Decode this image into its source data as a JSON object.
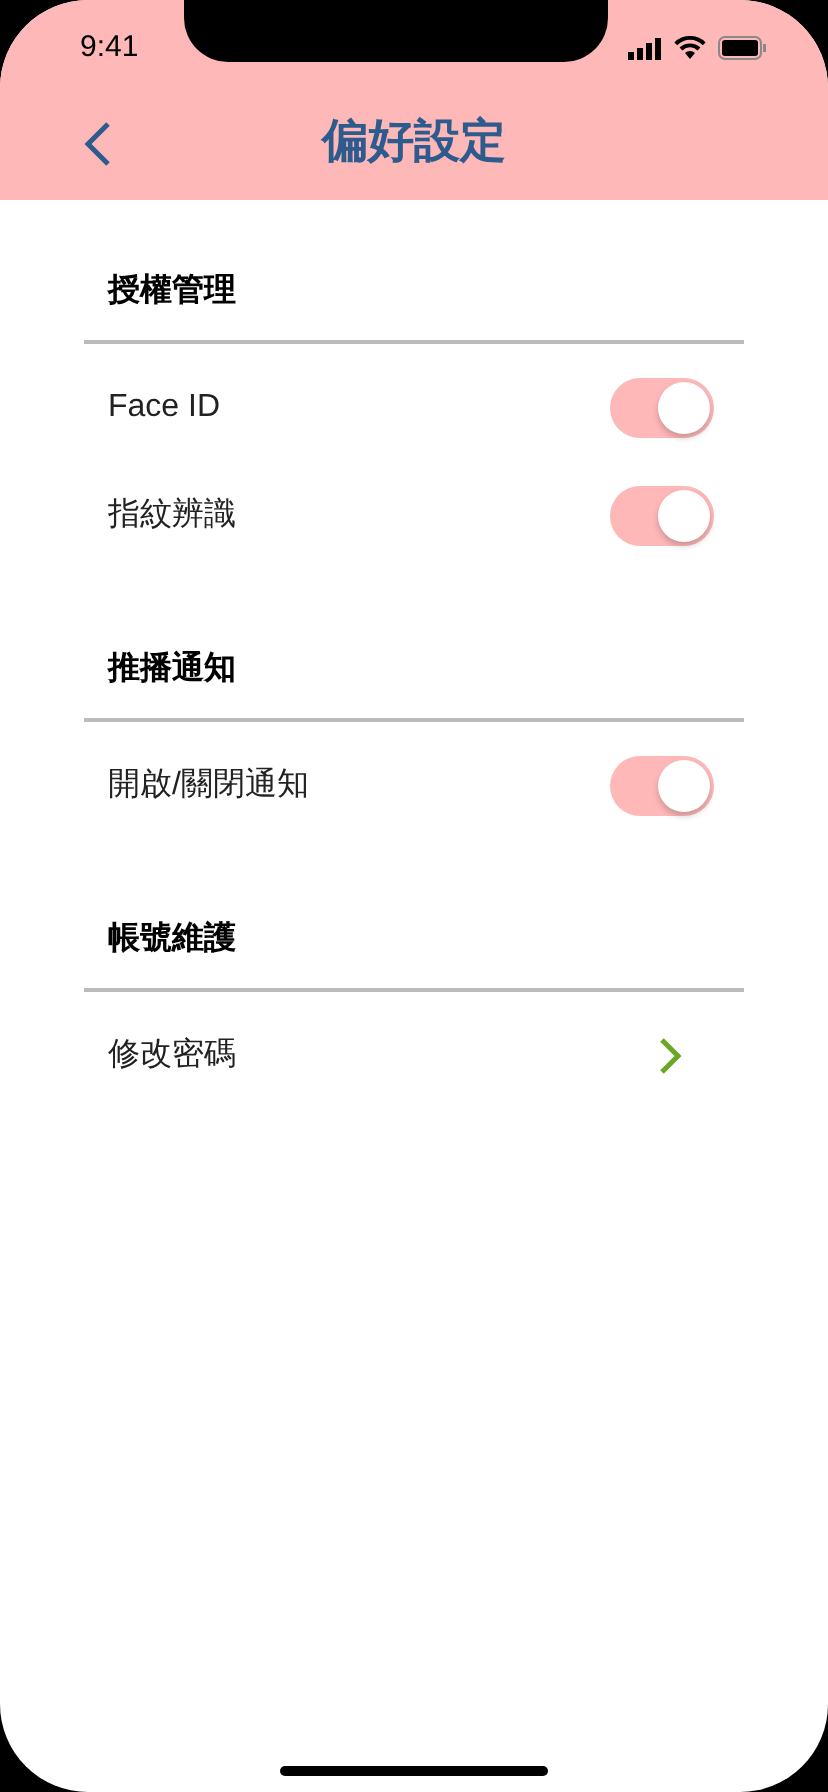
{
  "status_bar": {
    "time": "9:41"
  },
  "header": {
    "title": "偏好設定"
  },
  "sections": [
    {
      "title": "授權管理",
      "items": [
        {
          "label": "Face ID",
          "kind": "toggle",
          "on": true
        },
        {
          "label": "指紋辨識",
          "kind": "toggle",
          "on": true
        }
      ]
    },
    {
      "title": "推播通知",
      "items": [
        {
          "label": "開啟/關閉通知",
          "kind": "toggle",
          "on": true
        }
      ]
    },
    {
      "title": "帳號維護",
      "items": [
        {
          "label": "修改密碼",
          "kind": "link"
        }
      ]
    }
  ]
}
